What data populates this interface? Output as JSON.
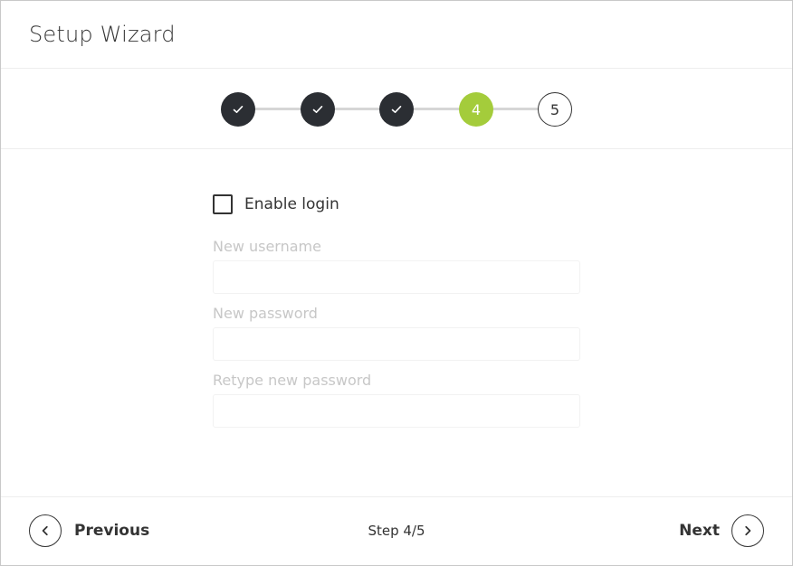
{
  "header": {
    "title": "Setup Wizard"
  },
  "stepper": {
    "steps": [
      {
        "label": "✓",
        "state": "done"
      },
      {
        "label": "✓",
        "state": "done"
      },
      {
        "label": "✓",
        "state": "done"
      },
      {
        "label": "4",
        "state": "current"
      },
      {
        "label": "5",
        "state": "todo"
      }
    ],
    "colors": {
      "done": "#2b2e33",
      "current": "#a4cc3b",
      "connector": "#d6d6d6"
    }
  },
  "form": {
    "enable_login_label": "Enable login",
    "enable_login_checked": false,
    "username": {
      "label": "New username",
      "value": ""
    },
    "password": {
      "label": "New password",
      "value": ""
    },
    "retype_password": {
      "label": "Retype new password",
      "value": ""
    }
  },
  "footer": {
    "previous_label": "Previous",
    "next_label": "Next",
    "step_indicator": "Step 4/5",
    "icons": {
      "previous": "chevron-left-icon",
      "next": "chevron-right-icon"
    }
  }
}
